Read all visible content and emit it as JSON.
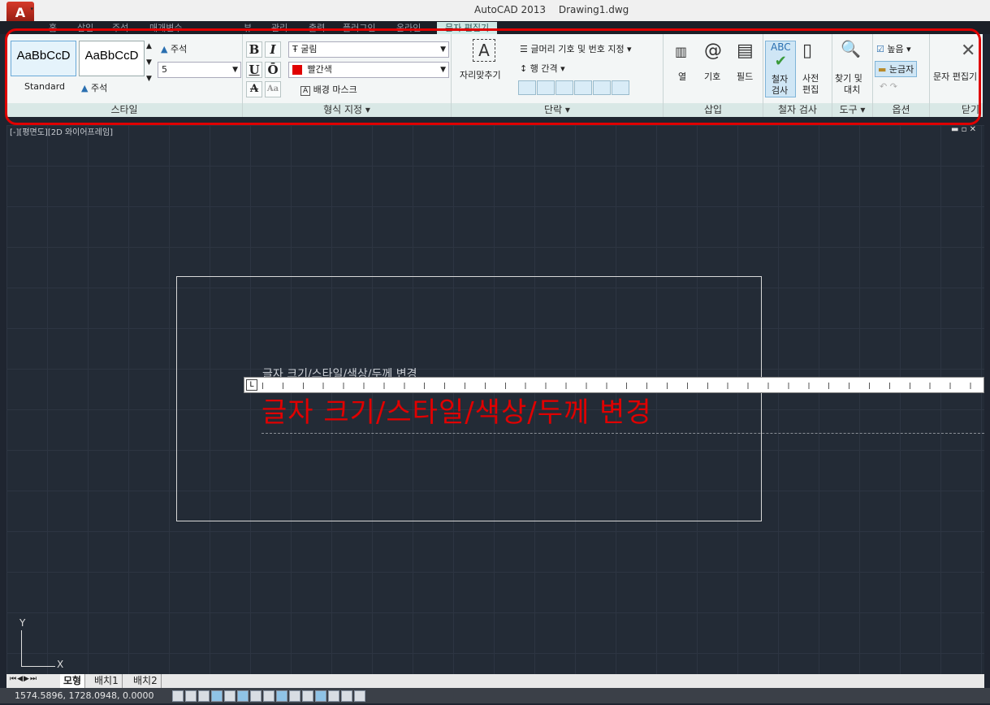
{
  "window": {
    "app": "AutoCAD 2013",
    "document": "Drawing1.dwg"
  },
  "menu_tabs": [
    "홈",
    "삽입",
    "주석",
    "매개변수",
    "뷰",
    "관리",
    "출력",
    "플러그인",
    "온라인",
    "문자 편집기"
  ],
  "ribbon": {
    "style_panel": {
      "label": "스타일",
      "card1_text": "AaBbCcD",
      "card1_name": "Standard",
      "card2_text": "AaBbCcD",
      "card2_name": "주석",
      "annotative_label": "주석",
      "size_value": "5"
    },
    "format_panel": {
      "label": "형식 지정 ▾",
      "bold": "B",
      "italic": "I",
      "underline": "U",
      "overline": "Ō",
      "font": "굴림",
      "color": "빨간색",
      "strike": "A",
      "case": "Aa",
      "mask": "배경 마스크"
    },
    "paragraph_panel": {
      "label": "단락 ▾",
      "justify": "자리맞추기",
      "bullets": "글머리 기호 및 번호 지정 ▾",
      "line_spacing": "행 간격 ▾"
    },
    "insert_panel": {
      "label": "삽입",
      "columns": "열",
      "symbol": "기호",
      "field": "필드"
    },
    "spell_panel": {
      "label": "철자 검사",
      "check_line1": "철자",
      "check_line2": "검사",
      "dict_line1": "사전",
      "dict_line2": "편집"
    },
    "tools_panel": {
      "label": "도구 ▾",
      "find_line1": "찾기 및",
      "find_line2": "대치"
    },
    "options_panel": {
      "label": "옵션",
      "more": "높음 ▾",
      "ruler": "눈금자"
    },
    "close_panel": {
      "label": "닫기",
      "close_editor": "문자 편집기"
    }
  },
  "viewport": {
    "label": "[-][평면도][2D 와이어프레임]",
    "ghost_text": "글자 크기/스타일/색상/두께 변경",
    "edit_text": "글자 크기/스타일/색상/두께 변경",
    "ucs_y": "Y",
    "ucs_x": "X"
  },
  "layout_tabs": [
    "모형",
    "배치1",
    "배치2"
  ],
  "status": {
    "coordinates": "1574.5896, 1728.0948, 0.0000"
  },
  "colors": {
    "accent": "#e00000",
    "canvas": "#232b36"
  }
}
